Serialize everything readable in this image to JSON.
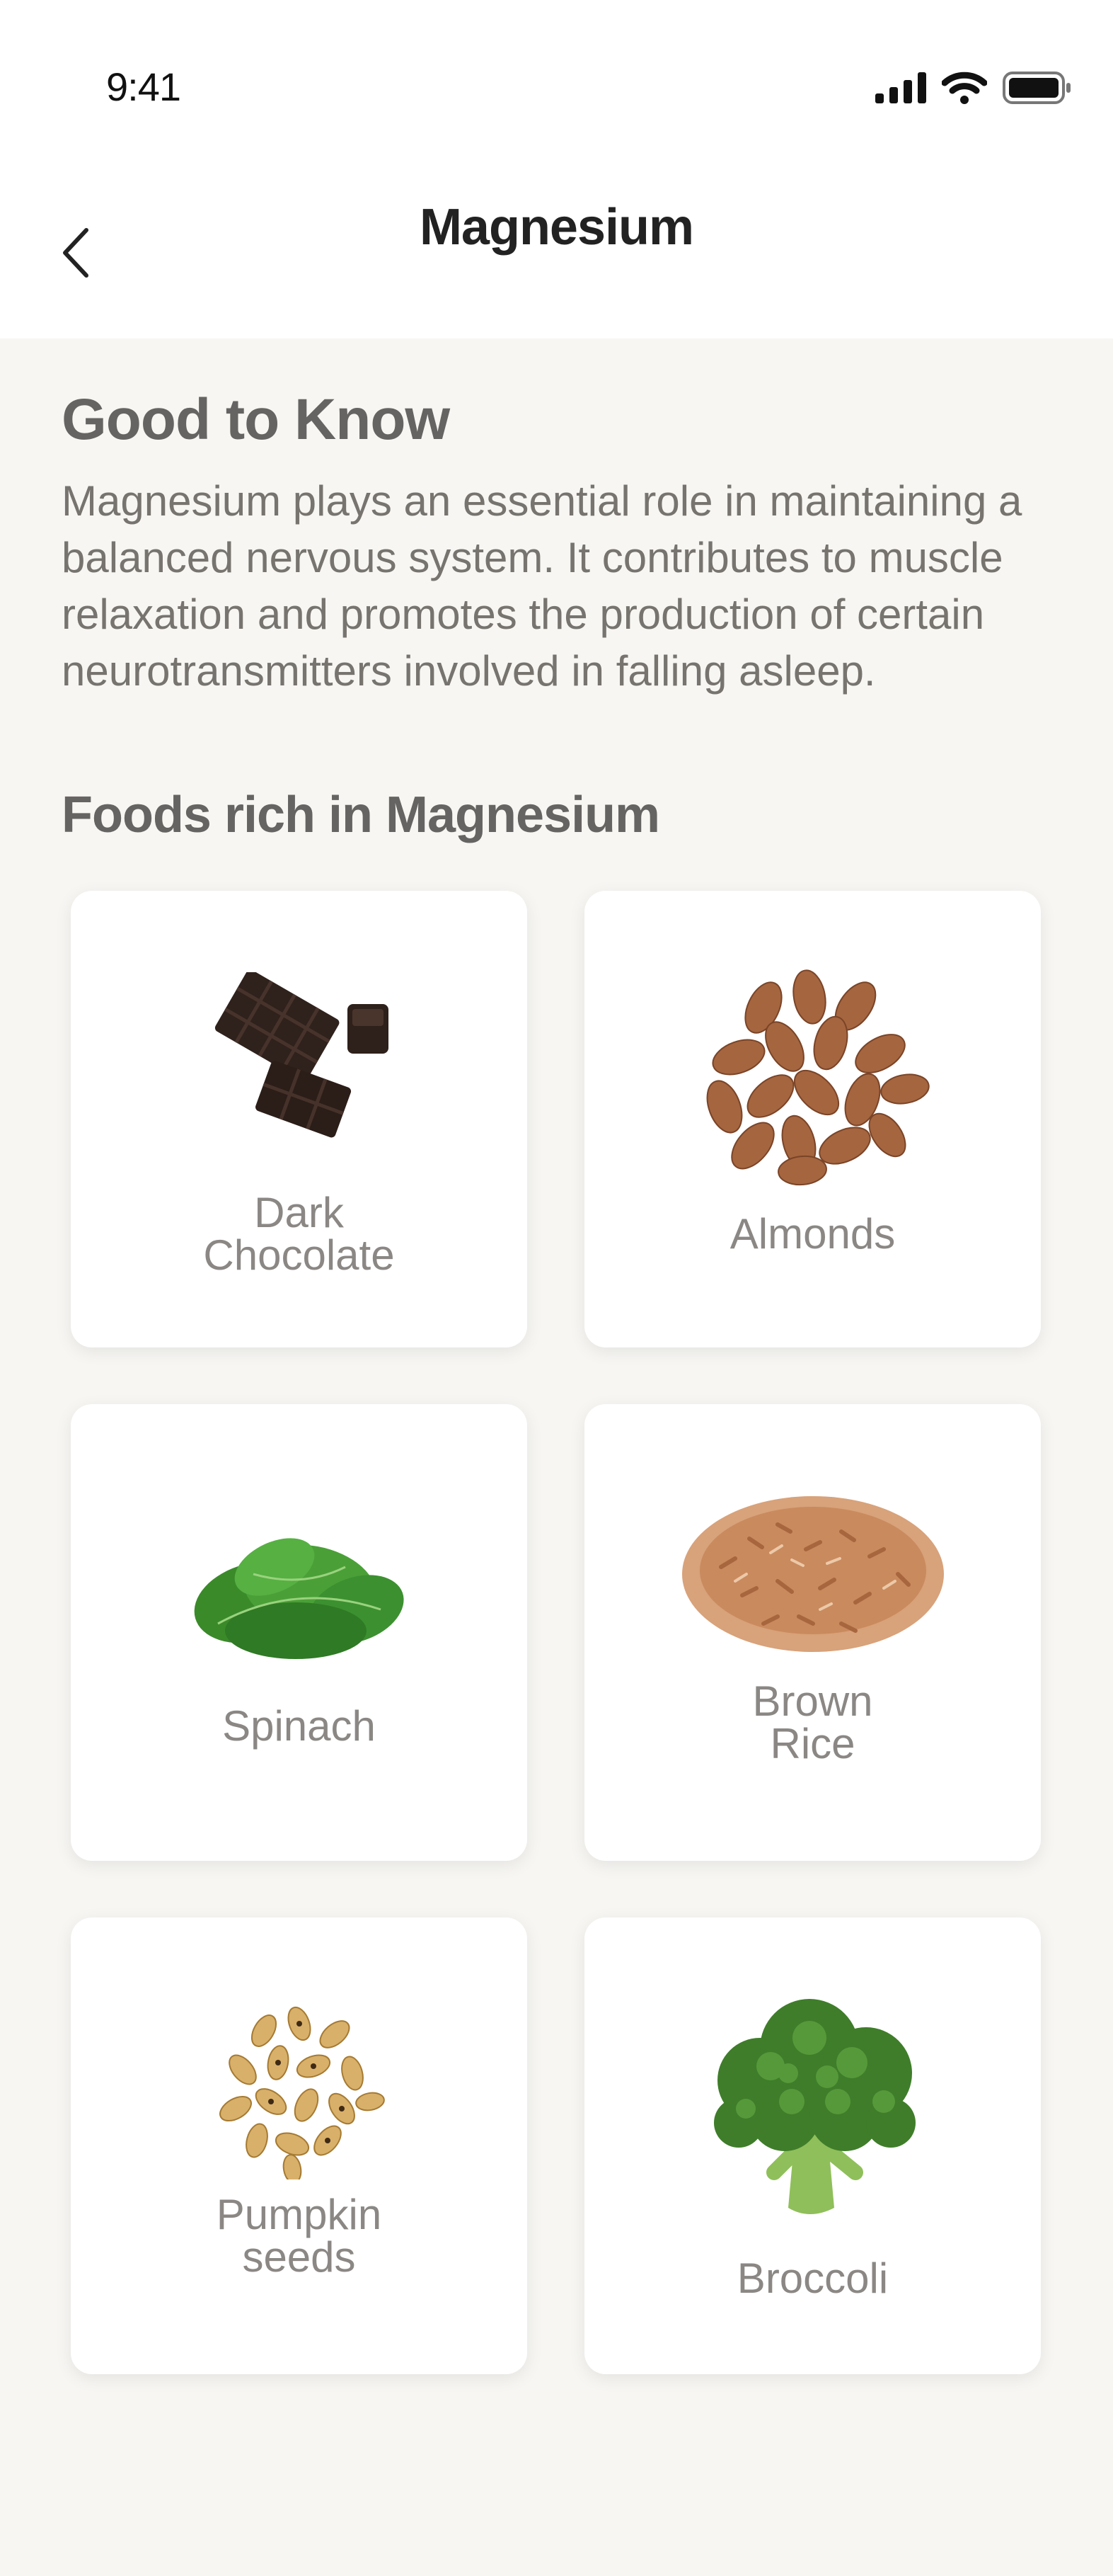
{
  "status": {
    "time": "9:41"
  },
  "nav": {
    "title": "Magnesium"
  },
  "info": {
    "heading": "Good to Know",
    "body": "Magnesium plays an essential role in maintaining a balanced nervous system. It contributes to muscle relaxation and promotes the production of certain neurotransmitters involved in falling asleep."
  },
  "foods": {
    "heading": "Foods rich in Magnesium",
    "items": [
      {
        "line1": "Dark",
        "line2": "Chocolate"
      },
      {
        "line1": "Almonds",
        "line2": ""
      },
      {
        "line1": "Spinach",
        "line2": ""
      },
      {
        "line1": "Brown",
        "line2": "Rice"
      },
      {
        "line1": "Pumpkin",
        "line2": "seeds"
      },
      {
        "line1": "Broccoli",
        "line2": ""
      }
    ]
  }
}
